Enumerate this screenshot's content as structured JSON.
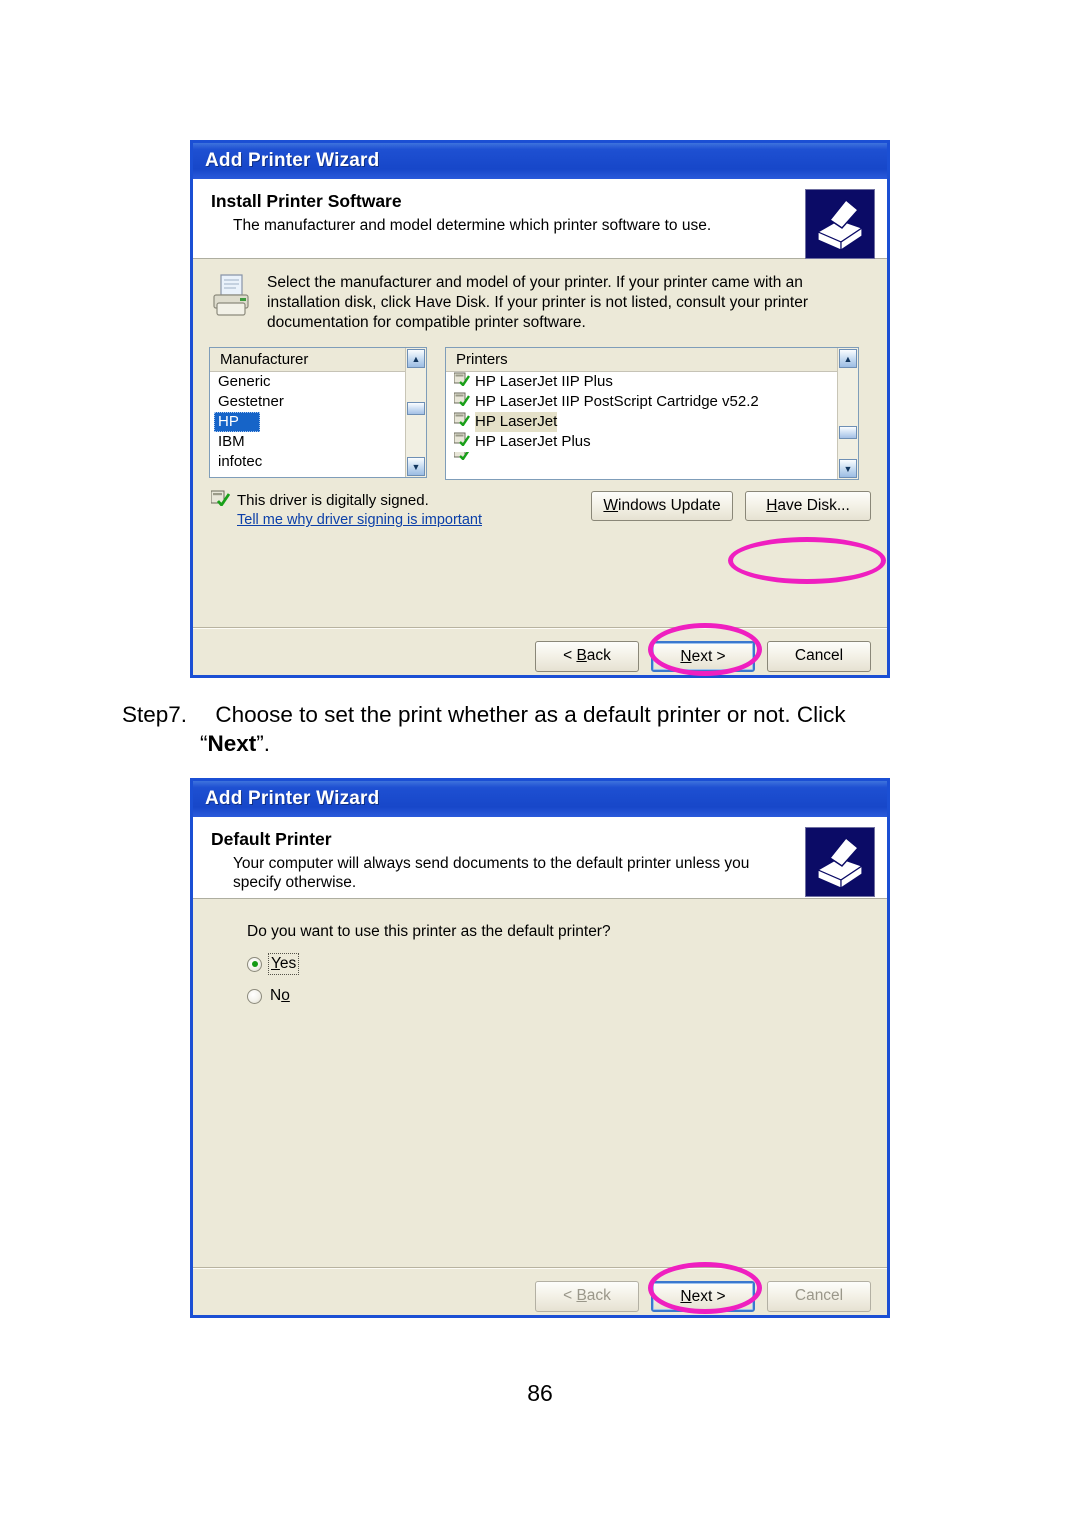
{
  "document": {
    "page_number": "86"
  },
  "step": {
    "label": "Step7.",
    "text": "Choose to set the print whether as a default printer or not. Click",
    "quote_open": "“",
    "emphasis": "Next",
    "quote_close": "”."
  },
  "dialog1": {
    "title": "Add Printer Wizard",
    "header_title": "Install Printer Software",
    "header_sub": "The manufacturer and model determine which printer software to use.",
    "icon": "printer-wizard-icon",
    "intro_icon": "printer-icon",
    "intro_text": "Select the manufacturer and model of your printer. If your printer came with an installation disk, click Have Disk. If your printer is not listed, consult your printer documentation for compatible printer software.",
    "manufacturer_list": {
      "header": "Manufacturer",
      "items": [
        {
          "label": "Generic",
          "selected": false
        },
        {
          "label": "Gestetner",
          "selected": false
        },
        {
          "label": "HP",
          "selected": true
        },
        {
          "label": "IBM",
          "selected": false
        },
        {
          "label": "infotec",
          "selected": false
        }
      ]
    },
    "printers_list": {
      "header": "Printers",
      "items": [
        {
          "label": "HP LaserJet IIP Plus",
          "selected": false
        },
        {
          "label": "HP LaserJet IIP PostScript Cartridge v52.2",
          "selected": false
        },
        {
          "label": "HP LaserJet",
          "selected": true
        },
        {
          "label": "HP LaserJet Plus",
          "selected": false
        }
      ]
    },
    "signed_text": "This driver is digitally signed.",
    "signed_link": "Tell me why driver signing is important",
    "windows_update_button": "Windows Update",
    "windows_update_accel": "W",
    "have_disk_button": "Have Disk...",
    "have_disk_accel": "H",
    "back_button": "< Back",
    "back_accel": "B",
    "next_button": "Next >",
    "next_accel": "N",
    "cancel_button": "Cancel",
    "highlight_color": "#EF1FC0",
    "highlighted": [
      "have-disk-button",
      "next-button"
    ]
  },
  "dialog2": {
    "title": "Add Printer Wizard",
    "header_title": "Default Printer",
    "header_sub": "Your computer will always send documents to the default printer unless you specify otherwise.",
    "icon": "printer-wizard-icon",
    "question": "Do you want to use this printer as the default printer?",
    "options": [
      {
        "label": "Yes",
        "accel": "Y",
        "checked": true,
        "focused": true
      },
      {
        "label": "No",
        "accel": "o",
        "checked": false,
        "focused": false
      }
    ],
    "back_button": "< Back",
    "back_accel": "B",
    "next_button": "Next >",
    "next_accel": "N",
    "cancel_button": "Cancel",
    "back_disabled": true,
    "cancel_disabled": true,
    "highlight_color": "#EF1FC0",
    "highlighted": [
      "next-button"
    ]
  },
  "colors": {
    "titlebar_blue": "#1E50D2",
    "dialog_face": "#ECE9D8",
    "selection_blue": "#1664C8",
    "link_blue": "#0B3FA8",
    "highlight_magenta": "#EF1FC0"
  }
}
